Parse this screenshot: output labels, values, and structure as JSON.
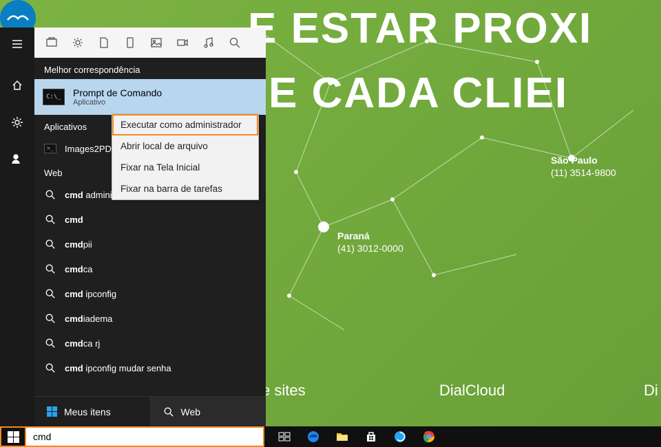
{
  "desktop": {
    "headline1": "E ESTAR PROXI",
    "headline2": "E CADA CLIEI",
    "city1": {
      "name": "São Paulo",
      "phone": "(11) 3514-9800"
    },
    "city2": {
      "name": "Paraná",
      "phone": "(41) 3012-0000"
    },
    "service1": "e sites",
    "service2": "DialCloud",
    "service3": "Di"
  },
  "panel": {
    "best_header": "Melhor correspondência",
    "apps_header": "Aplicativos",
    "web_header": "Web",
    "best": {
      "title": "Prompt de Comando",
      "subtitle": "Aplicativo"
    },
    "app1": "Images2PD",
    "web_results": [
      {
        "bold": "cmd",
        "rest": " administrador"
      },
      {
        "bold": "cmd",
        "rest": ""
      },
      {
        "bold": "cmd",
        "rest": "pii"
      },
      {
        "bold": "cmd",
        "rest": "ca"
      },
      {
        "bold": "cmd",
        "rest": " ipconfig"
      },
      {
        "bold": "cmd",
        "rest": "iadema"
      },
      {
        "bold": "cmd",
        "rest": "ca rj"
      },
      {
        "bold": "cmd",
        "rest": " ipconfig mudar senha"
      }
    ],
    "scope_my": "Meus itens",
    "scope_web": "Web"
  },
  "context_menu": {
    "items": [
      "Executar como administrador",
      "Abrir local de arquivo",
      "Fixar na Tela Inicial",
      "Fixar na barra de tarefas"
    ]
  },
  "taskbar": {
    "search_value": "cmd"
  }
}
